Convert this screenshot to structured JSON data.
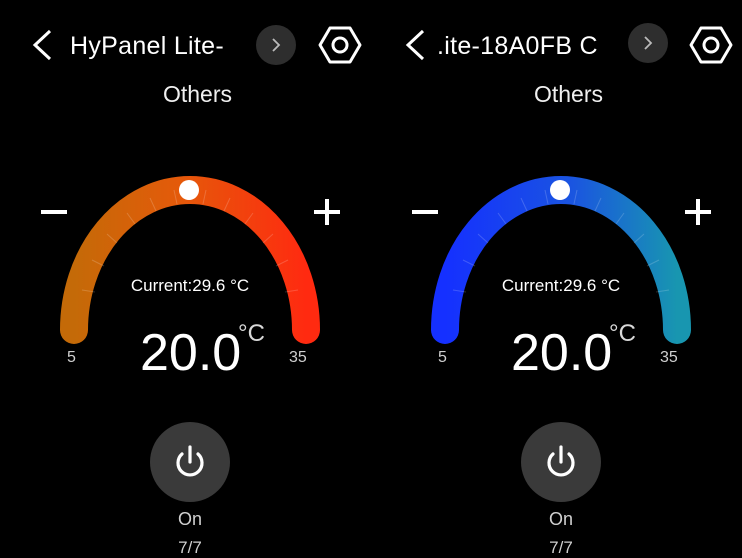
{
  "panels": [
    {
      "title": "HyPanel Lite-",
      "subtitle": "Others",
      "current": "Current:29.6 °C",
      "setpoint": "20.0",
      "unit": "°C",
      "min": "5",
      "max": "35",
      "state": "On",
      "page": "7/7",
      "gradient_start": "#c46a08",
      "gradient_end": "#ff2a10",
      "icons": {
        "back": "chevron-left-icon",
        "next": "chevron-right-icon",
        "settings": "gear-icon",
        "minus": "minus-icon",
        "plus": "plus-icon",
        "power": "power-icon"
      }
    },
    {
      "title": ".ite-18A0FB C",
      "subtitle": "Others",
      "current": "Current:29.6 °C",
      "setpoint": "20.0",
      "unit": "°C",
      "min": "5",
      "max": "35",
      "state": "On",
      "page": "7/7",
      "gradient_start": "#1530ff",
      "gradient_end": "#1896b0",
      "icons": {
        "back": "chevron-left-icon",
        "next": "chevron-right-icon",
        "settings": "gear-icon",
        "minus": "minus-icon",
        "plus": "plus-icon",
        "power": "power-icon"
      }
    }
  ]
}
